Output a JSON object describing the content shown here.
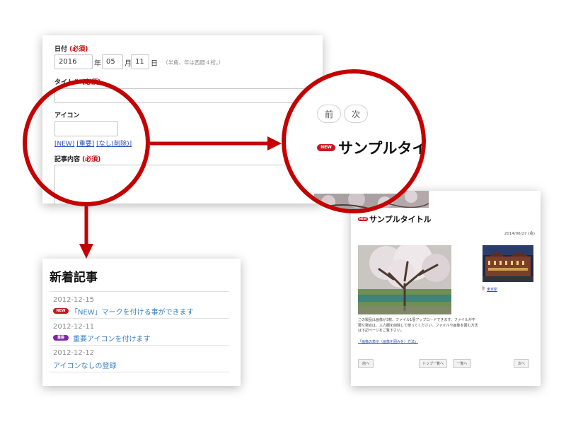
{
  "form": {
    "date_label": "日付",
    "required_mark": "(必須)",
    "year_value": "2016",
    "year_unit": "年",
    "month_value": "05",
    "month_unit": "月",
    "day_value": "11",
    "day_unit": "日",
    "date_hint": "（半角、年は西暦４桁。）",
    "title_label": "タイトル",
    "icon_label": "アイコン",
    "icon_options": [
      "[NEW]",
      "[重要]",
      "[なし(削除)]"
    ],
    "content_label": "記事内容"
  },
  "news": {
    "heading": "新着記事",
    "items": [
      {
        "date": "2012-12-15",
        "badge": "NEW",
        "text": "「NEW」マークを付ける事ができます"
      },
      {
        "date": "2012-12-11",
        "badge": "重要",
        "text": "重要アイコンを付けます"
      },
      {
        "date": "2012-12-12",
        "badge": "",
        "text": "アイコンなしの登録"
      }
    ]
  },
  "detail": {
    "badge": "NEW",
    "title": "サンプルタイトル",
    "date": "2014/06/27 (金)",
    "body": "この製品は画像が3枚、ファイル1個アップロードできます。ファイルが不要な場合は、入力欄を削除して使ってください。ファイルや画像を囲む方法は下記ページをご覧下さい。",
    "caption": "東京駅",
    "link": "「画像の表示（画像を囲みを）方法」",
    "buttons": {
      "prev": "前へ",
      "top": "トップ一覧へ",
      "list": "一覧へ",
      "next": "次へ"
    }
  },
  "zoom": {
    "prev": "前",
    "next": "次",
    "badge": "NEW",
    "title": "サンプルタイ"
  },
  "colors": {
    "accent_red": "#c40000",
    "badge_new": "#c8161d",
    "badge_important": "#8026a8",
    "link_blue": "#3a7fc0"
  }
}
